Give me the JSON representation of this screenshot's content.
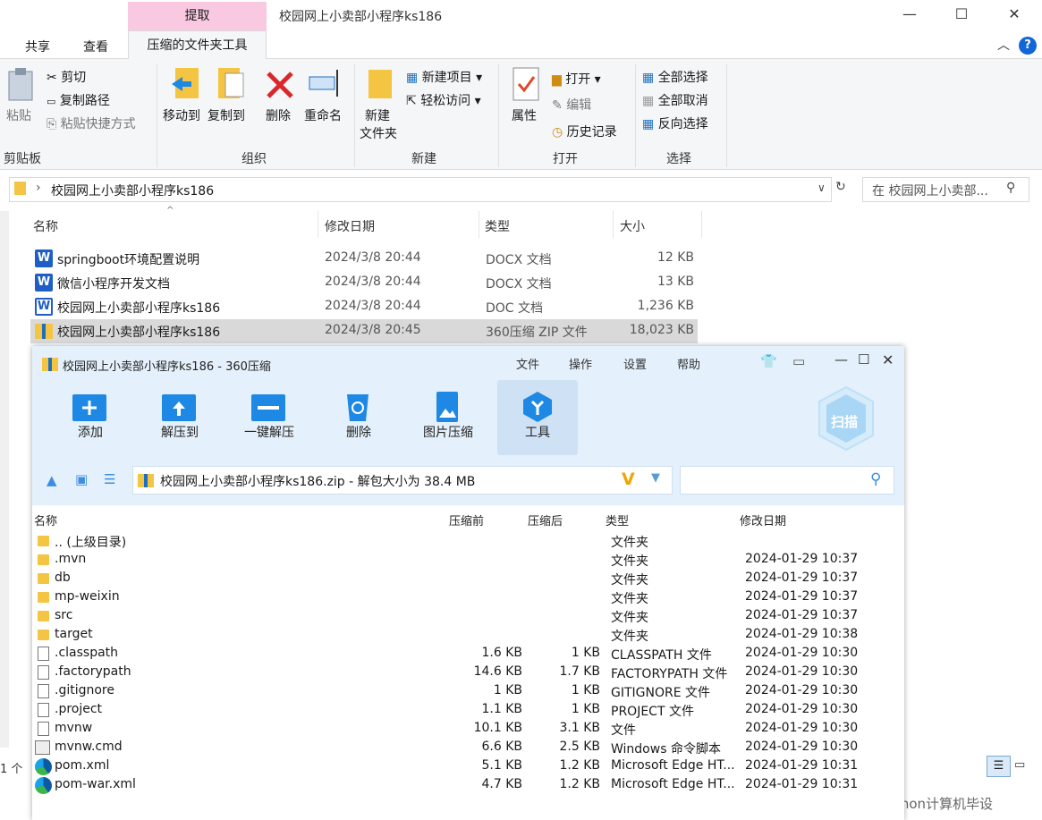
{
  "explorer": {
    "context_tab": "提取",
    "title": "校园网上小卖部小程序ks186",
    "tabs": [
      "共享",
      "查看",
      "压缩的文件夹工具"
    ],
    "ribbon": {
      "clipboard": {
        "paste": "粘贴",
        "cut": "剪切",
        "copy_path": "复制路径",
        "paste_shortcut": "粘贴快捷方式",
        "group": "剪贴板"
      },
      "organize": {
        "move_to": "移动到",
        "copy_to": "复制到",
        "delete": "删除",
        "rename": "重命名",
        "group": "组织"
      },
      "new": {
        "new_folder_1": "新建",
        "new_folder_2": "文件夹",
        "new_item": "新建项目",
        "easy_access": "轻松访问",
        "group": "新建"
      },
      "open": {
        "properties": "属性",
        "open": "打开",
        "edit": "编辑",
        "history": "历史记录",
        "group": "打开"
      },
      "select": {
        "select_all": "全部选择",
        "select_none": "全部取消",
        "invert": "反向选择",
        "group": "选择"
      }
    },
    "address": "校园网上小卖部小程序ks186",
    "search_placeholder": "在 校园网上小卖部...",
    "columns": {
      "name": "名称",
      "modified": "修改日期",
      "type": "类型",
      "size": "大小"
    },
    "files": [
      {
        "name": "springboot环境配置说明",
        "modified": "2024/3/8 20:44",
        "type": "DOCX 文档",
        "size": "12 KB"
      },
      {
        "name": "微信小程序开发文档",
        "modified": "2024/3/8 20:44",
        "type": "DOCX 文档",
        "size": "13 KB"
      },
      {
        "name": "校园网上小卖部小程序ks186",
        "modified": "2024/3/8 20:44",
        "type": "DOC 文档",
        "size": "1,236 KB"
      },
      {
        "name": "校园网上小卖部小程序ks186",
        "modified": "2024/3/8 20:45",
        "type": "360压缩 ZIP 文件",
        "size": "18,023 KB"
      }
    ],
    "status_left": "1 个",
    "watermark": "CSDN @python计算机毕设"
  },
  "zip": {
    "title": "校园网上小卖部小程序ks186 - 360压缩",
    "menu": [
      "文件",
      "操作",
      "设置",
      "帮助"
    ],
    "toolbar": [
      "添加",
      "解压到",
      "一键解压",
      "删除",
      "图片压缩",
      "工具"
    ],
    "scan": "扫描",
    "path": "校园网上小卖部小程序ks186.zip - 解包大小为 38.4 MB",
    "columns": {
      "name": "名称",
      "before": "压缩前",
      "after": "压缩后",
      "type": "类型",
      "modified": "修改日期"
    },
    "rows": [
      {
        "name": ".. (上级目录)",
        "before": "",
        "after": "",
        "type": "文件夹",
        "modified": "",
        "icon": "folder"
      },
      {
        "name": ".mvn",
        "before": "",
        "after": "",
        "type": "文件夹",
        "modified": "2024-01-29 10:37",
        "icon": "folder"
      },
      {
        "name": "db",
        "before": "",
        "after": "",
        "type": "文件夹",
        "modified": "2024-01-29 10:37",
        "icon": "folder"
      },
      {
        "name": "mp-weixin",
        "before": "",
        "after": "",
        "type": "文件夹",
        "modified": "2024-01-29 10:37",
        "icon": "folder"
      },
      {
        "name": "src",
        "before": "",
        "after": "",
        "type": "文件夹",
        "modified": "2024-01-29 10:37",
        "icon": "folder"
      },
      {
        "name": "target",
        "before": "",
        "after": "",
        "type": "文件夹",
        "modified": "2024-01-29 10:38",
        "icon": "folder"
      },
      {
        "name": ".classpath",
        "before": "1.6 KB",
        "after": "1 KB",
        "type": "CLASSPATH 文件",
        "modified": "2024-01-29 10:30",
        "icon": "file"
      },
      {
        "name": ".factorypath",
        "before": "14.6 KB",
        "after": "1.7 KB",
        "type": "FACTORYPATH 文件",
        "modified": "2024-01-29 10:30",
        "icon": "file"
      },
      {
        "name": ".gitignore",
        "before": "1 KB",
        "after": "1 KB",
        "type": "GITIGNORE 文件",
        "modified": "2024-01-29 10:30",
        "icon": "file"
      },
      {
        "name": ".project",
        "before": "1.1 KB",
        "after": "1 KB",
        "type": "PROJECT 文件",
        "modified": "2024-01-29 10:30",
        "icon": "file"
      },
      {
        "name": "mvnw",
        "before": "10.1 KB",
        "after": "3.1 KB",
        "type": "文件",
        "modified": "2024-01-29 10:30",
        "icon": "file"
      },
      {
        "name": "mvnw.cmd",
        "before": "6.6 KB",
        "after": "2.5 KB",
        "type": "Windows 命令脚本",
        "modified": "2024-01-29 10:30",
        "icon": "cmd"
      },
      {
        "name": "pom.xml",
        "before": "5.1 KB",
        "after": "1.2 KB",
        "type": "Microsoft Edge HT...",
        "modified": "2024-01-29 10:31",
        "icon": "edge"
      },
      {
        "name": "pom-war.xml",
        "before": "4.7 KB",
        "after": "1.2 KB",
        "type": "Microsoft Edge HT...",
        "modified": "2024-01-29 10:31",
        "icon": "edge"
      }
    ]
  }
}
